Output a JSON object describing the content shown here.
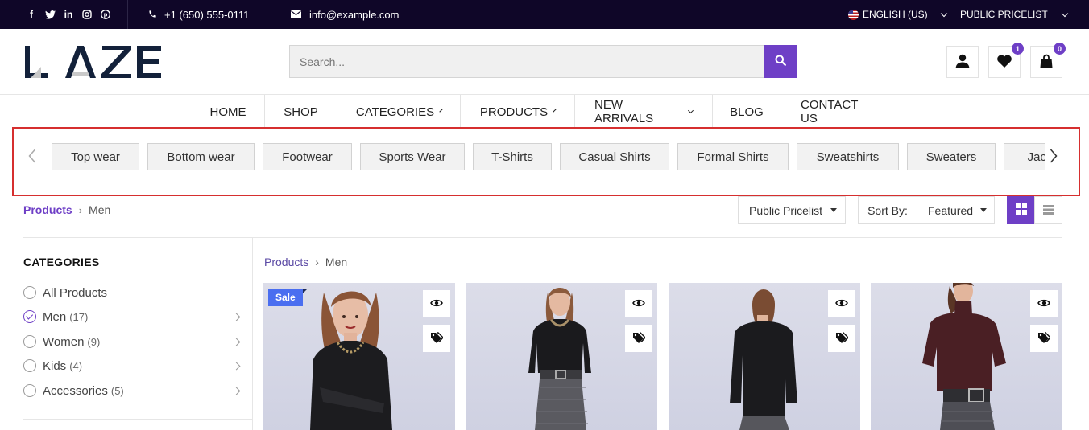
{
  "topbar": {
    "social_icons": [
      "facebook-icon",
      "twitter-icon",
      "linkedin-icon",
      "instagram-icon",
      "pinterest-icon"
    ],
    "phone": "+1 (650) 555-0111",
    "email": "info@example.com",
    "language": "ENGLISH (US)",
    "pricelist": "PUBLIC PRICELIST"
  },
  "header": {
    "logo_text": "LAZE",
    "search_placeholder": "Search...",
    "wishlist_count": "1",
    "cart_count": "0"
  },
  "nav": {
    "items": [
      "HOME",
      "SHOP",
      "CATEGORIES",
      "PRODUCTS",
      "NEW ARRIVALS",
      "BLOG",
      "CONTACT US"
    ]
  },
  "chips": [
    "Top wear",
    "Bottom wear",
    "Footwear",
    "Sports Wear",
    "T-Shirts",
    "Casual Shirts",
    "Formal Shirts",
    "Sweatshirts",
    "Sweaters",
    "Jackets"
  ],
  "breadcrumb": {
    "parent": "Products",
    "current": "Men"
  },
  "toolbar": {
    "pricelist": "Public Pricelist",
    "sort_label": "Sort By:",
    "sort_value": "Featured"
  },
  "sidebar": {
    "title": "CATEGORIES",
    "items": [
      {
        "label": "All Products",
        "count": ""
      },
      {
        "label": "Men",
        "count": "(17)"
      },
      {
        "label": "Women",
        "count": "(9)"
      },
      {
        "label": "Kids",
        "count": "(4)"
      },
      {
        "label": "Accessories",
        "count": "(5)"
      }
    ]
  },
  "products": {
    "breadcrumb_parent": "Products",
    "breadcrumb_current": "Men",
    "sale_badge": "Sale"
  },
  "colors": {
    "accent": "#6e3fc6",
    "topbar": "#0f0628",
    "sale": "#4a6ef0",
    "highlight_frame": "#d62f2f"
  }
}
